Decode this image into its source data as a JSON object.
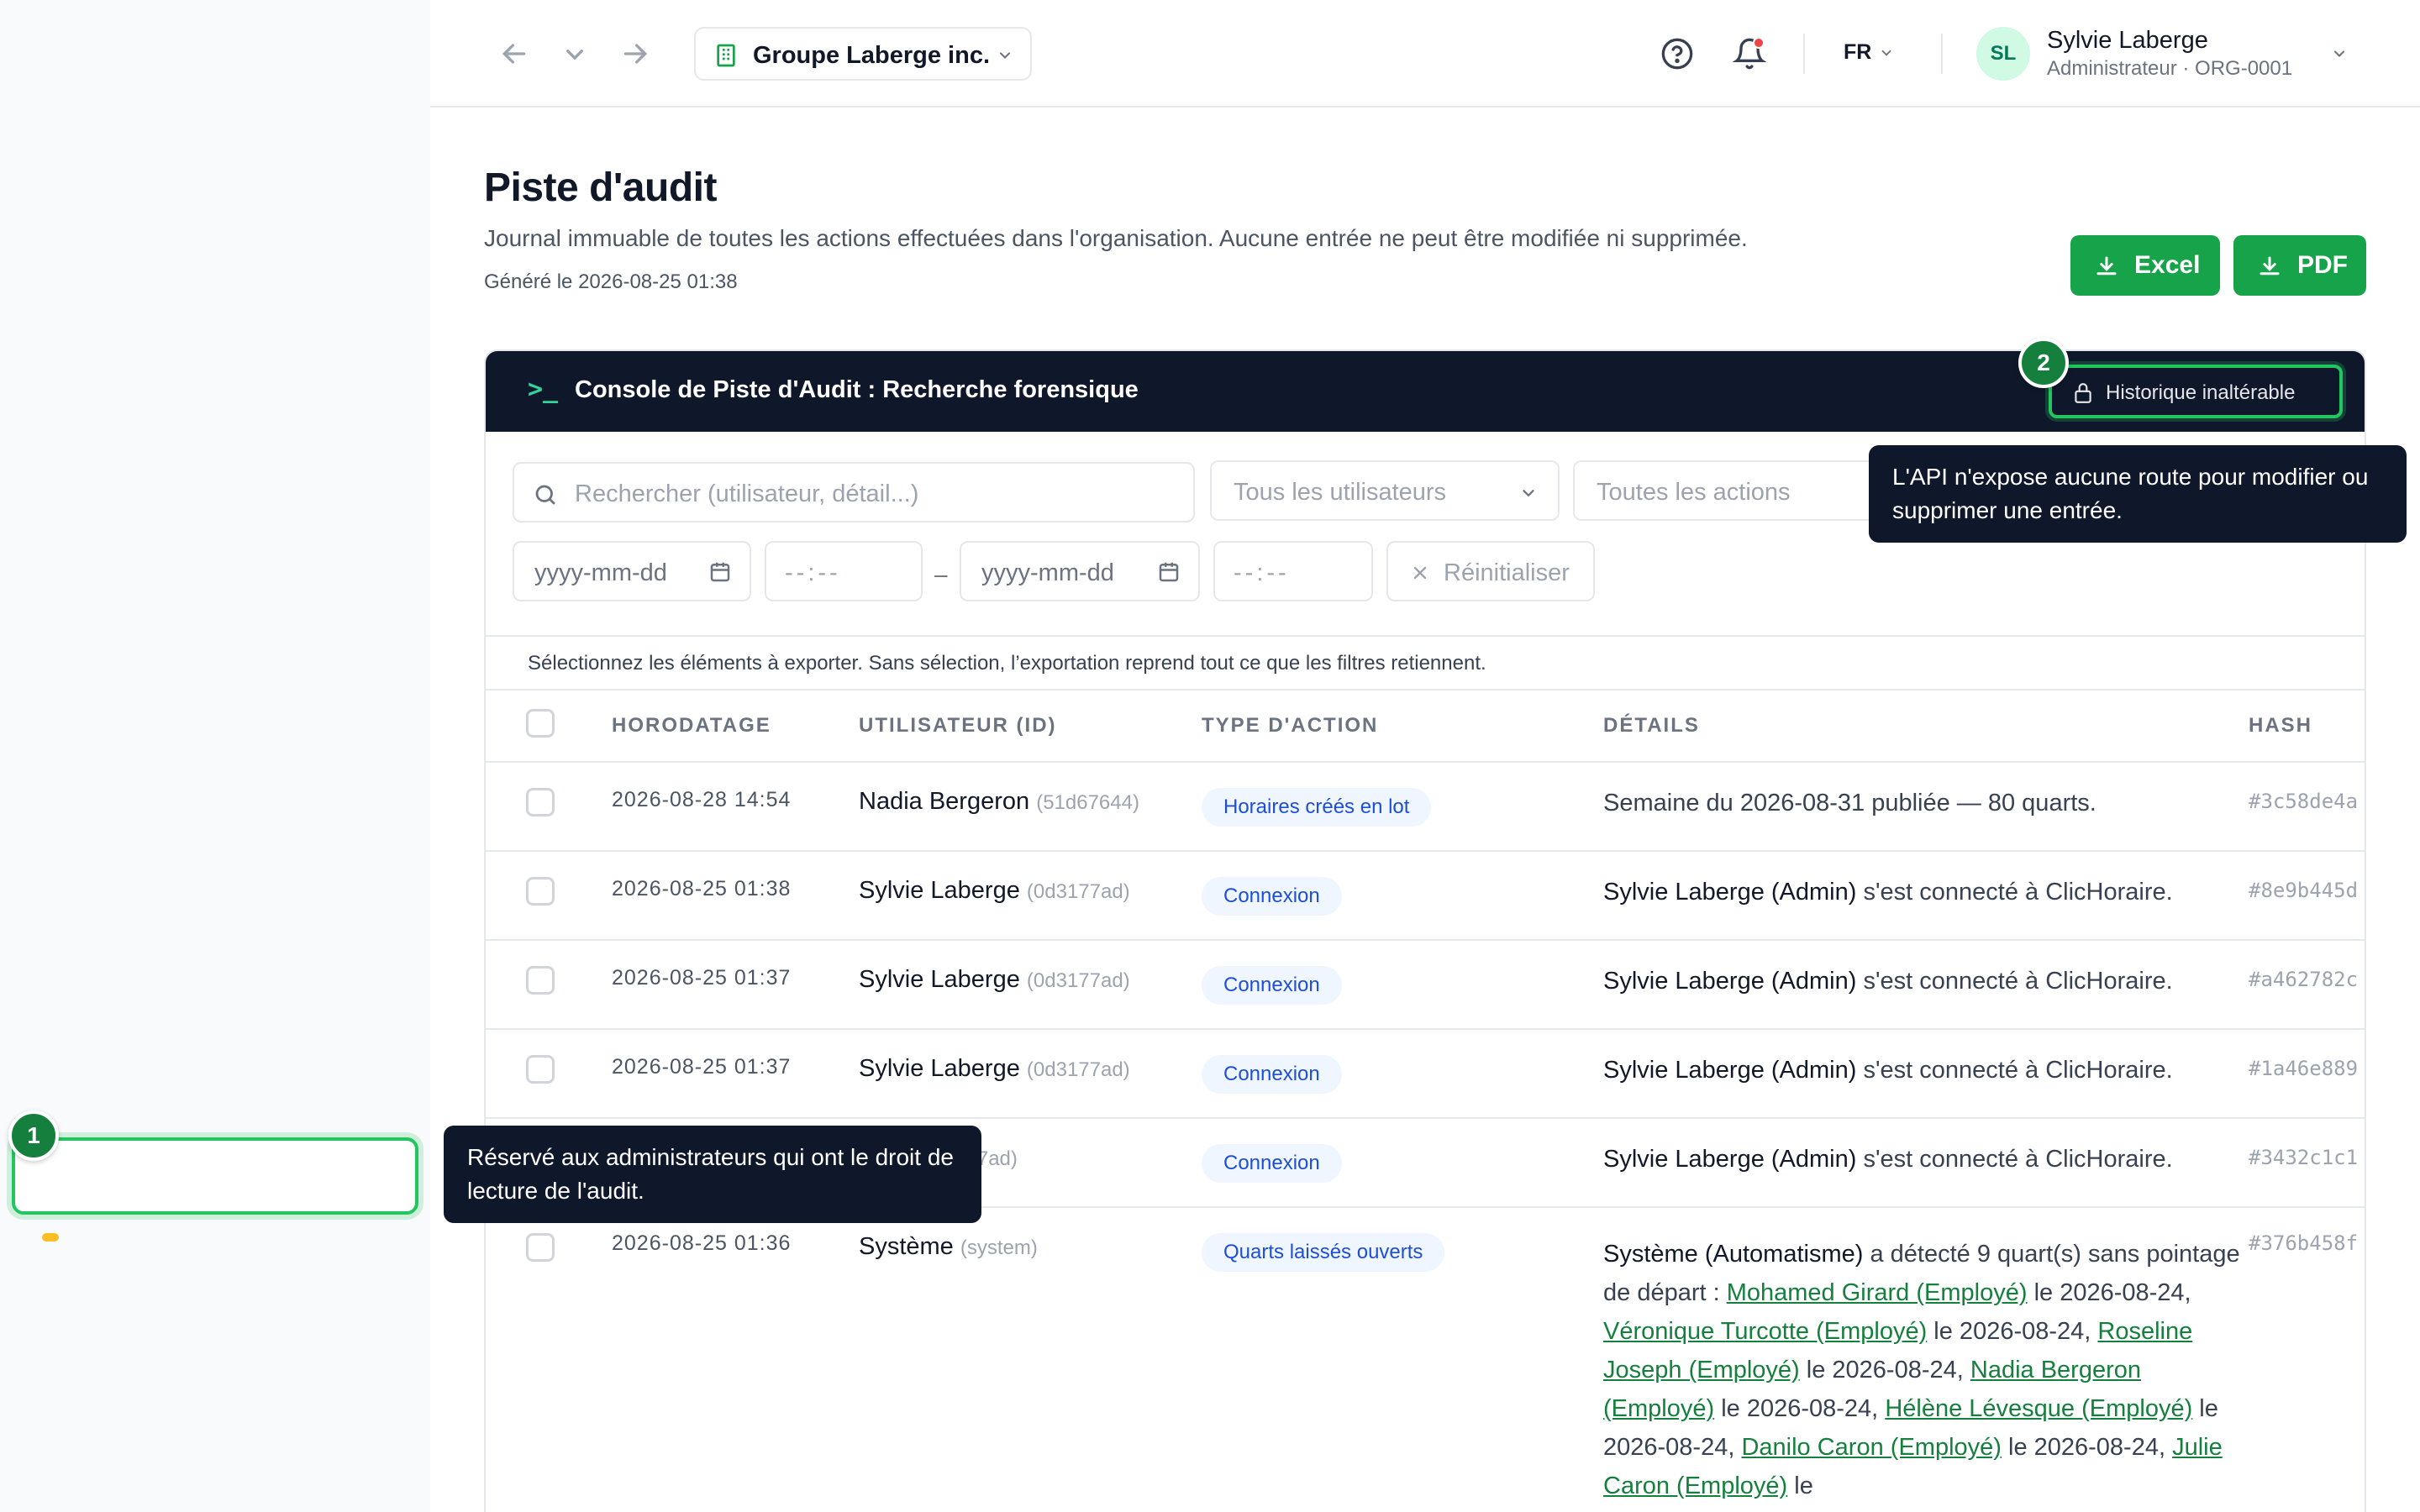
{
  "org": {
    "name": "Groupe Laberge inc."
  },
  "lang": "FR",
  "user": {
    "initials": "SL",
    "name": "Sylvie Laberge",
    "role": "Administrateur · ORG-0001"
  },
  "page": {
    "title": "Piste d'audit",
    "description": "Journal immuable de toutes les actions effectuées dans l'organisation. Aucune entrée ne peut être modifiée ni supprimée.",
    "generated": "Généré le 2026-08-25 01:38"
  },
  "export": {
    "excel": "Excel",
    "pdf": "PDF"
  },
  "console": {
    "prompt": ">_",
    "title": "Console de Piste d'Audit : Recherche forensique",
    "immutable_label": "Historique inaltérable"
  },
  "filters": {
    "search_placeholder": "Rechercher (utilisateur, détail...)",
    "users_select": "Tous les utilisateurs",
    "actions_select": "Toutes les actions",
    "date_from": "yyyy-mm-dd",
    "time_from": "--:--",
    "date_to": "yyyy-mm-dd",
    "time_to": "--:--",
    "dash": "–",
    "reset": "Réinitialiser"
  },
  "hint": "Sélectionnez les éléments à exporter. Sans sélection, l’exportation reprend tout ce que les filtres retiennent.",
  "table": {
    "headers": [
      "HORODATAGE",
      "UTILISATEUR (ID)",
      "TYPE D'ACTION",
      "DÉTAILS",
      "HASH"
    ],
    "rows": [
      {
        "ts": "2026-08-28 14:54",
        "user": "Nadia Bergeron",
        "uid": "(51d67644)",
        "action": "Horaires créés en lot",
        "detail_bold": "",
        "detail": "Semaine du 2026-08-31 publiée — 80 quarts.",
        "hash": "#3c58de4a"
      },
      {
        "ts": "2026-08-25 01:38",
        "user": "Sylvie Laberge",
        "uid": "(0d3177ad)",
        "action": "Connexion",
        "detail_bold": "Sylvie Laberge (Admin)",
        "detail": " s'est connecté à ClicHoraire.",
        "hash": "#8e9b445d"
      },
      {
        "ts": "2026-08-25 01:37",
        "user": "Sylvie Laberge",
        "uid": "(0d3177ad)",
        "action": "Connexion",
        "detail_bold": "Sylvie Laberge (Admin)",
        "detail": " s'est connecté à ClicHoraire.",
        "hash": "#a462782c"
      },
      {
        "ts": "2026-08-25 01:37",
        "user": "Sylvie Laberge",
        "uid": "(0d3177ad)",
        "action": "Connexion",
        "detail_bold": "Sylvie Laberge (Admin)",
        "detail": " s'est connecté à ClicHoraire.",
        "hash": "#1a46e889"
      },
      {
        "ts": "",
        "user": "erge",
        "uid": "(0d3177ad)",
        "action": "Connexion",
        "detail_bold": "Sylvie Laberge (Admin)",
        "detail": " s'est connecté à ClicHoraire.",
        "hash": "#3432c1c1"
      },
      {
        "ts": "2026-08-25 01:36",
        "user": "Système",
        "uid": "(system)",
        "action": "Quarts laissés ouverts",
        "hash": "#376b458f"
      }
    ],
    "system_detail": {
      "bold": "Système (Automatisme)",
      "intro": " a détecté 9 quart(s) sans pointage de départ : ",
      "segments": [
        {
          "link": "Mohamed Girard (Employé)",
          "text": " le 2026-08-24, "
        },
        {
          "link": "Véronique Turcotte (Employé)",
          "text": " le 2026-08-24, "
        },
        {
          "link": "Roseline Joseph (Employé)",
          "text": " le 2026-08-24, "
        },
        {
          "link": "Nadia Bergeron (Employé)",
          "text": " le 2026-08-24, "
        },
        {
          "link": "Hélène Lévesque (Employé)",
          "text": " le 2026-08-24, "
        },
        {
          "link": "Danilo Caron (Employé)",
          "text": " le 2026-08-24, "
        },
        {
          "link": "Julie Caron (Employé)",
          "text": " le"
        }
      ]
    }
  },
  "tour": {
    "step1": {
      "number": "1",
      "text": "Réservé aux administrateurs qui ont le droit de lecture de l'audit."
    },
    "step2": {
      "number": "2",
      "text": "L'API n'expose aucune route pour modifier ou supprimer une entrée."
    }
  },
  "colors": {
    "accent": "#16a34a",
    "console_bg": "#0f172a",
    "link": "#15803d",
    "badge_bg": "#eff6ff",
    "badge_text": "#1d4ed8"
  }
}
